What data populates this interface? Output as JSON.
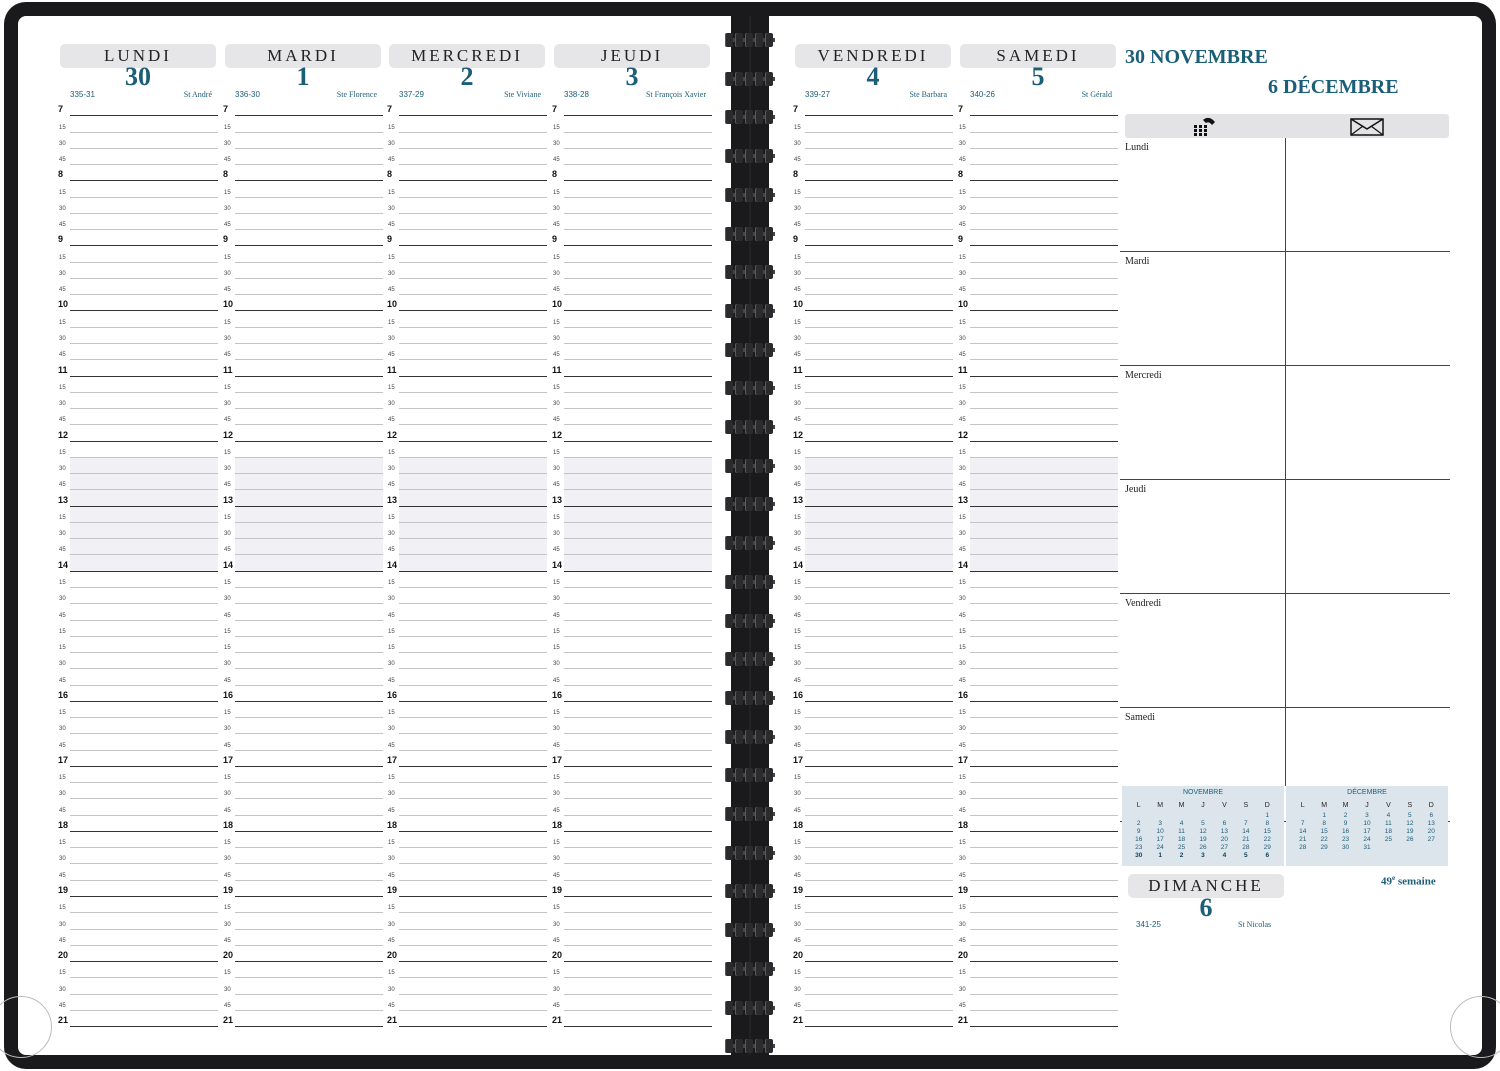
{
  "days": [
    {
      "name": "LUNDI",
      "number": "30",
      "dayno": "335-31",
      "saint": "St André"
    },
    {
      "name": "MARDI",
      "number": "1",
      "dayno": "336-30",
      "saint": "Ste Florence"
    },
    {
      "name": "MERCREDI",
      "number": "2",
      "dayno": "337-29",
      "saint": "Ste Viviane"
    },
    {
      "name": "JEUDI",
      "number": "3",
      "dayno": "338-28",
      "saint": "St François Xavier"
    },
    {
      "name": "VENDREDI",
      "number": "4",
      "dayno": "339-27",
      "saint": "Ste Barbara"
    },
    {
      "name": "SAMEDI",
      "number": "5",
      "dayno": "340-26",
      "saint": "St Gérald"
    }
  ],
  "time_slots": [
    "7",
    "15",
    "30",
    "45",
    "8",
    "15",
    "30",
    "45",
    "9",
    "15",
    "30",
    "45",
    "10",
    "15",
    "30",
    "45",
    "11",
    "15",
    "30",
    "45",
    "12",
    "15",
    "30",
    "45",
    "13",
    "15",
    "30",
    "45",
    "14",
    "15",
    "30",
    "45",
    "15",
    "15",
    "30",
    "45",
    "16",
    "15",
    "30",
    "45",
    "17",
    "15",
    "30",
    "45",
    "18",
    "15",
    "30",
    "45",
    "19",
    "15",
    "30",
    "45",
    "20",
    "15",
    "30",
    "45",
    "21"
  ],
  "week": {
    "title_start": "30 NOVEMBRE",
    "title_end": "6 DÉCEMBRE",
    "icons": {
      "left": "phone-keypad-icon",
      "right": "envelope-icon"
    },
    "note_days": [
      "Lundi",
      "Mardi",
      "Mercredi",
      "Jeudi",
      "Vendredi",
      "Samedi"
    ],
    "week_label": "49e semaine"
  },
  "mini_calendars": [
    {
      "title": "NOVEMBRE",
      "headers": [
        "L",
        "M",
        "M",
        "J",
        "V",
        "S",
        "D"
      ],
      "rows": [
        [
          "",
          "",
          "",
          "",
          "",
          "",
          "1"
        ],
        [
          "2",
          "3",
          "4",
          "5",
          "6",
          "7",
          "8"
        ],
        [
          "9",
          "10",
          "11",
          "12",
          "13",
          "14",
          "15"
        ],
        [
          "16",
          "17",
          "18",
          "19",
          "20",
          "21",
          "22"
        ],
        [
          "23",
          "24",
          "25",
          "26",
          "27",
          "28",
          "29"
        ],
        [
          "30",
          "1",
          "2",
          "3",
          "4",
          "5",
          "6"
        ]
      ]
    },
    {
      "title": "DÉCEMBRE",
      "headers": [
        "L",
        "M",
        "M",
        "J",
        "V",
        "S",
        "D"
      ],
      "rows": [
        [
          "",
          "1",
          "2",
          "3",
          "4",
          "5",
          "6"
        ],
        [
          "7",
          "8",
          "9",
          "10",
          "11",
          "12",
          "13"
        ],
        [
          "14",
          "15",
          "16",
          "17",
          "18",
          "19",
          "20"
        ],
        [
          "21",
          "22",
          "23",
          "24",
          "25",
          "26",
          "27"
        ],
        [
          "28",
          "29",
          "30",
          "31",
          "",
          "",
          ""
        ]
      ]
    }
  ],
  "sunday": {
    "name": "DIMANCHE",
    "number": "6",
    "dayno": "341-25",
    "saint": "St Nicolas"
  },
  "colors": {
    "accent": "#1c5e78",
    "cover": "#1a1a1c",
    "header_bg": "#e6e6e8",
    "lunch_band": "#f1f1f5"
  }
}
